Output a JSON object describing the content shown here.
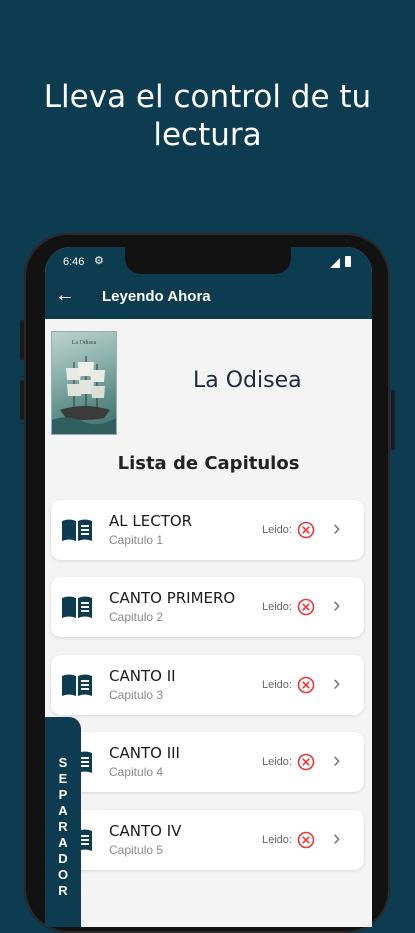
{
  "promo": {
    "title_line1": "Lleva el control de tu",
    "title_line2": "lectura"
  },
  "status_bar": {
    "time": "6:46"
  },
  "app_bar": {
    "title": "Leyendo Ahora"
  },
  "book": {
    "title": "La Odisea",
    "cover_text": "La Odisea"
  },
  "list": {
    "heading": "Lista de Capitulos"
  },
  "chapters": [
    {
      "name": "AL LECTOR",
      "number": "Capitulo 1",
      "read_label": "Leido:"
    },
    {
      "name": "CANTO PRIMERO",
      "number": "Capitulo 2",
      "read_label": "Leido:"
    },
    {
      "name": "CANTO II",
      "number": "Capitulo 3",
      "read_label": "Leido:"
    },
    {
      "name": "CANTO III",
      "number": "Capitulo 4",
      "read_label": "Leido:"
    },
    {
      "name": "CANTO IV",
      "number": "Capitulo 5",
      "read_label": "Leido:"
    }
  ],
  "bookmark_tab": {
    "label": "SEPARADOR",
    "letters": [
      "S",
      "E",
      "P",
      "A",
      "R",
      "A",
      "D",
      "O",
      "R"
    ]
  },
  "colors": {
    "primary": "#0d3b4f",
    "unread": "#e53935"
  }
}
